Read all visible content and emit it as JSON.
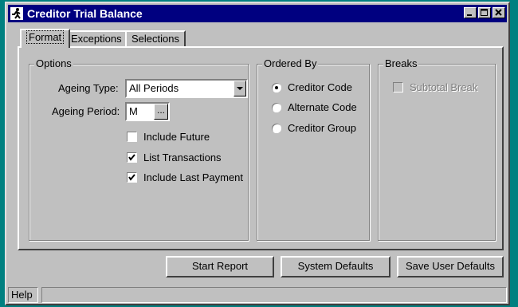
{
  "window": {
    "title": "Creditor Trial Balance",
    "icon": "runner-icon",
    "controls": [
      "minimize-icon",
      "maximize-icon",
      "close-icon"
    ]
  },
  "tabs": [
    {
      "label": "Format",
      "selected": true
    },
    {
      "label": "Exceptions",
      "selected": false
    },
    {
      "label": "Selections",
      "selected": false
    }
  ],
  "options": {
    "group_label": "Options",
    "ageing_type_label": "Ageing Type:",
    "ageing_type_value": "All Periods",
    "ageing_period_label": "Ageing Period:",
    "ageing_period_value": "M",
    "ellipsis": "...",
    "checks": [
      {
        "label": "Include Future",
        "checked": false
      },
      {
        "label": "List Transactions",
        "checked": true
      },
      {
        "label": "Include Last Payment",
        "checked": true
      }
    ]
  },
  "ordered_by": {
    "group_label": "Ordered By",
    "items": [
      {
        "label": "Creditor Code",
        "selected": true
      },
      {
        "label": "Alternate Code",
        "selected": false
      },
      {
        "label": "Creditor Group",
        "selected": false
      }
    ]
  },
  "breaks": {
    "group_label": "Breaks",
    "subtotal_label": "Subtotal Break",
    "subtotal_checked": false,
    "subtotal_enabled": false
  },
  "buttons": {
    "start_report": "Start Report",
    "system_defaults": "System Defaults",
    "save_user_defaults": "Save User Defaults"
  },
  "status": {
    "text": "Help"
  },
  "colors": {
    "desktop": "#008080",
    "titlebar": "#000080",
    "face": "#c0c0c0"
  }
}
